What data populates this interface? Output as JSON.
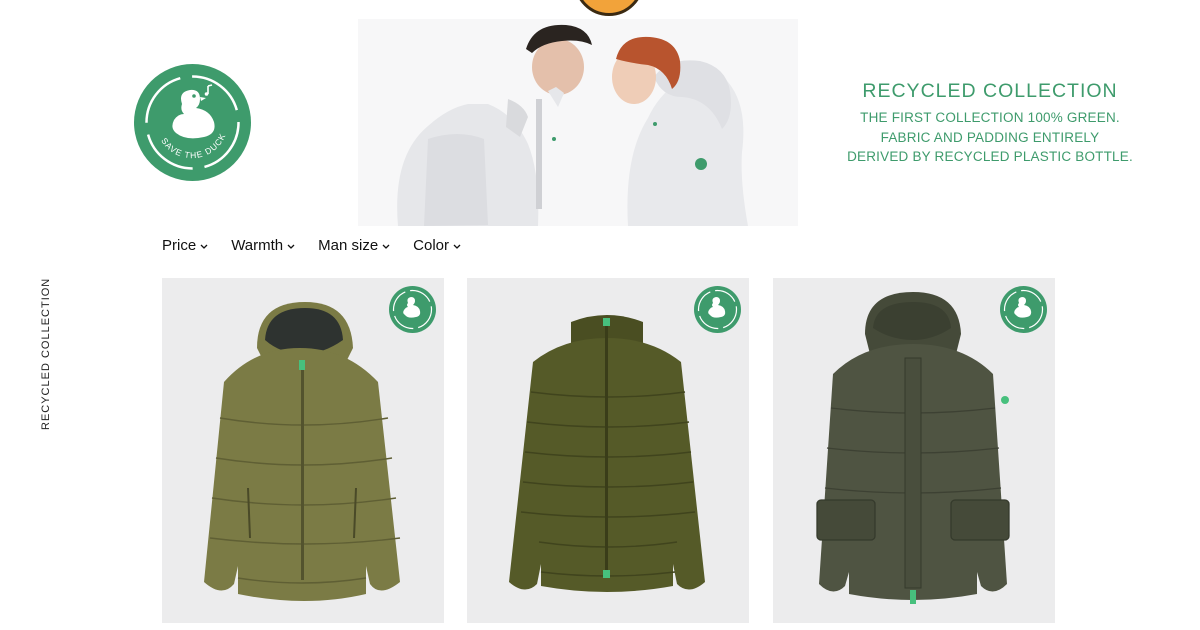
{
  "top_badge": {
    "text": "SAVE THE DUCK"
  },
  "brand": {
    "logo_text": "SAVE THE DUCK"
  },
  "promo": {
    "title": "RECYCLED COLLECTION",
    "lines": [
      "THE FIRST COLLECTION 100% GREEN.",
      "FABRIC AND PADDING ENTIRELY",
      "DERIVED BY RECYCLED PLASTIC BOTTLE."
    ]
  },
  "side_label": "RECYCLED COLLECTION",
  "filters": [
    {
      "label": "Price"
    },
    {
      "label": "Warmth"
    },
    {
      "label": "Man size"
    },
    {
      "label": "Color"
    }
  ],
  "products": [
    {
      "name": "hooded puffer jacket",
      "color": "#7b7b45",
      "hood_lining": "#2e3330"
    },
    {
      "name": "quilted puffer jacket",
      "color": "#555a28",
      "hood_lining": "#4a4e22"
    },
    {
      "name": "hooded parka",
      "color": "#4f5442",
      "hood_lining": "#454a39"
    }
  ],
  "colors": {
    "brand_green": "#3e9b6c",
    "card_bg": "#ececed",
    "zipper_accent": "#47c07d"
  }
}
